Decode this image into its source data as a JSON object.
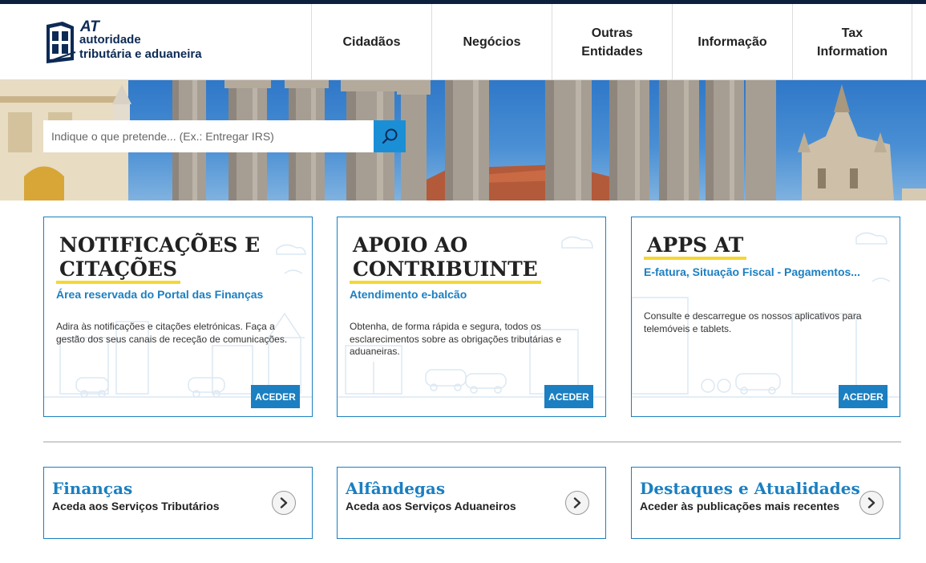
{
  "logo": {
    "abbr": "AT",
    "line1": "autoridade",
    "line2": "tributária e aduaneira"
  },
  "nav": {
    "items": [
      {
        "label": "Cidadãos"
      },
      {
        "label": "Negócios"
      },
      {
        "label": "Outras Entidades"
      },
      {
        "label": "Informação"
      },
      {
        "label": "Tax Information"
      }
    ]
  },
  "search": {
    "placeholder": "Indique o que pretende... (Ex.: Entregar IRS)"
  },
  "cards": [
    {
      "title_l1": "NOTIFICAÇÕES E",
      "title_l2": "CITAÇÕES",
      "subtitle": "Área reservada do Portal das Finanças",
      "text": "Adira às notificações e citações eletrónicas. Faça a gestão dos seus canais de receção de comunicações.",
      "button": "ACEDER"
    },
    {
      "title_l1": "APOIO AO",
      "title_l2": "CONTRIBUINTE",
      "subtitle": "Atendimento e-balcão",
      "text": "Obtenha, de forma rápida e segura, todos os esclarecimentos sobre as obrigações tributárias e aduaneiras.",
      "button": "ACEDER"
    },
    {
      "title_l1": "APPS AT",
      "subtitle": "E-fatura, Situação Fiscal - Pagamentos...",
      "text": "Consulte e descarregue os nossos aplicativos para telemóveis e tablets.",
      "button": "ACEDER"
    }
  ],
  "links": [
    {
      "title": "Finanças",
      "subtitle": "Aceda aos Serviços Tributários"
    },
    {
      "title": "Alfândegas",
      "subtitle": "Aceda aos Serviços Aduaneiros"
    },
    {
      "title": "Destaques e Atualidades",
      "subtitle": "Aceder às publicações mais recentes"
    }
  ],
  "colors": {
    "brand_navy": "#0d2a55",
    "accent_blue": "#1b7fc1",
    "highlight_yellow": "#f5d733"
  }
}
